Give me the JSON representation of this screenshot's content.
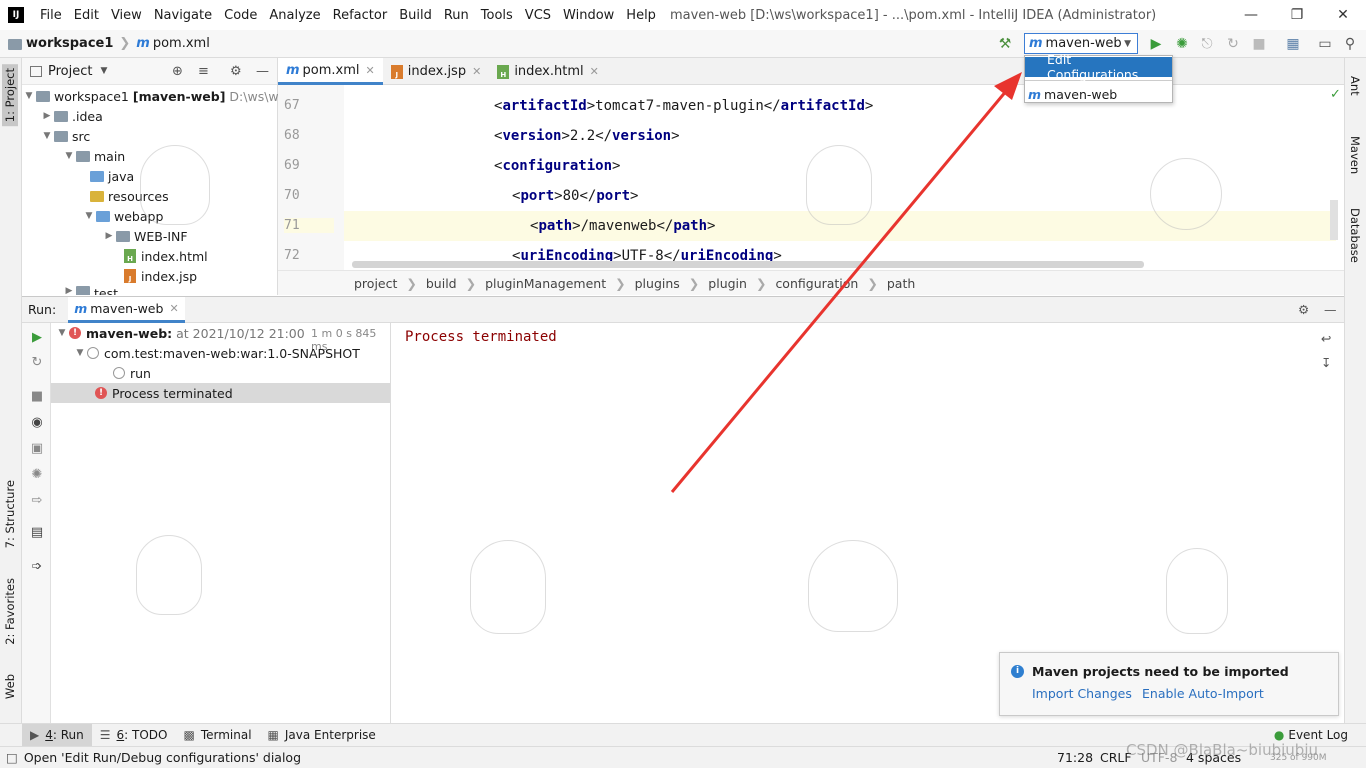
{
  "menubar": {
    "items": [
      "File",
      "Edit",
      "View",
      "Navigate",
      "Code",
      "Analyze",
      "Refactor",
      "Build",
      "Run",
      "Tools",
      "VCS",
      "Window",
      "Help"
    ],
    "title": "maven-web [D:\\ws\\workspace1] - ...\\pom.xml - IntelliJ IDEA (Administrator)"
  },
  "navbar": {
    "project": "workspace1",
    "file": "pom.xml"
  },
  "toolbar": {
    "run_config": "maven-web"
  },
  "dropdown": {
    "edit": "Edit Configurations...",
    "item": "maven-web"
  },
  "left_strip": {
    "project": "1: Project",
    "structure": "7: Structure",
    "favorites": "2: Favorites",
    "web": "Web"
  },
  "right_strip": {
    "ant": "Ant",
    "maven": "Maven",
    "database": "Database"
  },
  "project_panel": {
    "title": "Project",
    "root_name": "workspace1",
    "root_module": "[maven-web]",
    "root_path": "D:\\ws\\wo",
    "items": [
      ".idea",
      "src",
      "main",
      "java",
      "resources",
      "webapp",
      "WEB-INF",
      "index.html",
      "index.jsp",
      "test"
    ]
  },
  "editor_tabs": [
    {
      "label": "pom.xml"
    },
    {
      "label": "index.jsp"
    },
    {
      "label": "index.html"
    }
  ],
  "code": {
    "line_numbers": [
      "67",
      "68",
      "69",
      "70",
      "71",
      "72"
    ],
    "lines": [
      {
        "indent": "",
        "open": "artifactId",
        "text": "tomcat7-maven-plugin",
        "close": "artifactId"
      },
      {
        "indent": "",
        "open": "version",
        "text": "2.2",
        "close": "version"
      },
      {
        "indent": "",
        "open": "configuration",
        "text": "",
        "close": ""
      },
      {
        "indent": "  ",
        "open": "port",
        "text": "80",
        "close": "port"
      },
      {
        "indent": "    ",
        "open": "path",
        "text": "/mavenweb",
        "close": "path"
      },
      {
        "indent": "  ",
        "open": "uriEncoding",
        "text": "UTF-8",
        "close": "uriEncoding"
      }
    ]
  },
  "breadcrumbs": [
    "project",
    "build",
    "pluginManagement",
    "plugins",
    "plugin",
    "configuration",
    "path"
  ],
  "run_panel": {
    "label": "Run:",
    "tab": "maven-web",
    "tree": {
      "root": "maven-web:",
      "root_time": "at 2021/10/12 21:00",
      "root_duration": "1 m 0 s 845 ms",
      "child": "com.test:maven-web:war:1.0-SNAPSHOT",
      "leaf": "run",
      "terminated": "Process terminated"
    },
    "console": "Process terminated"
  },
  "notification": {
    "title": "Maven projects need to be imported",
    "action1": "Import Changes",
    "action2": "Enable Auto-Import"
  },
  "bottom_tabs": [
    {
      "num": "4",
      "label": ": Run"
    },
    {
      "num": "6",
      "label": ": TODO"
    },
    {
      "num": "",
      "label": "Terminal"
    },
    {
      "num": "",
      "label": "Java Enterprise"
    }
  ],
  "event_log": "Event Log",
  "status": {
    "message": "Open 'Edit Run/Debug configurations' dialog",
    "position": "71:28",
    "line_sep": "CRLF",
    "encoding": "UTF-8",
    "indent": "4 spaces",
    "memory": "325 of 990M",
    "watermark": "CSDN @BlaBla~biubiubiu"
  },
  "colors": {
    "accent": "#2675bf",
    "arrow": "#e8342e",
    "tag": "#000080",
    "console": "#8b0000"
  }
}
